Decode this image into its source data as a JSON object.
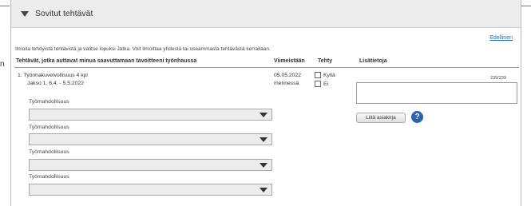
{
  "edge_letter": "n",
  "section": {
    "title": "Sovitut tehtävät"
  },
  "next_link": "Edellinen",
  "instructions": "Ilmoita tehdyistä tehtävistä ja valitse lopuksi Jatka. Voit ilmoittaa yhdestä tai useammasta tehtävästä kerrallaan.",
  "table": {
    "headers": {
      "task": "Tehtävät, jotka auttavat minua saavuttamaan tavoitteeni työnhaussa",
      "deadline": "Viimeistään",
      "done": "Tehty",
      "info": "Lisätietoja"
    },
    "row": {
      "task_line1": "1. Työnhakuvelvollisuus 4 kpl",
      "task_line2": "Jakso 1. 6.4. - 5.5.2022",
      "deadline_line1": "05.05.2022",
      "deadline_line2": "mennessä",
      "yes_label": "Kyllä",
      "no_label": "Ei",
      "counter": "239/239",
      "attach_button": "Liitä asiakirja",
      "help": "?"
    },
    "opportunities": [
      {
        "label": "Työmahdollisuus",
        "value": ""
      },
      {
        "label": "Työmahdollisuus",
        "value": ""
      },
      {
        "label": "Työmahdollisuus",
        "value": ""
      },
      {
        "label": "Työmahdollisuus",
        "value": ""
      }
    ]
  }
}
